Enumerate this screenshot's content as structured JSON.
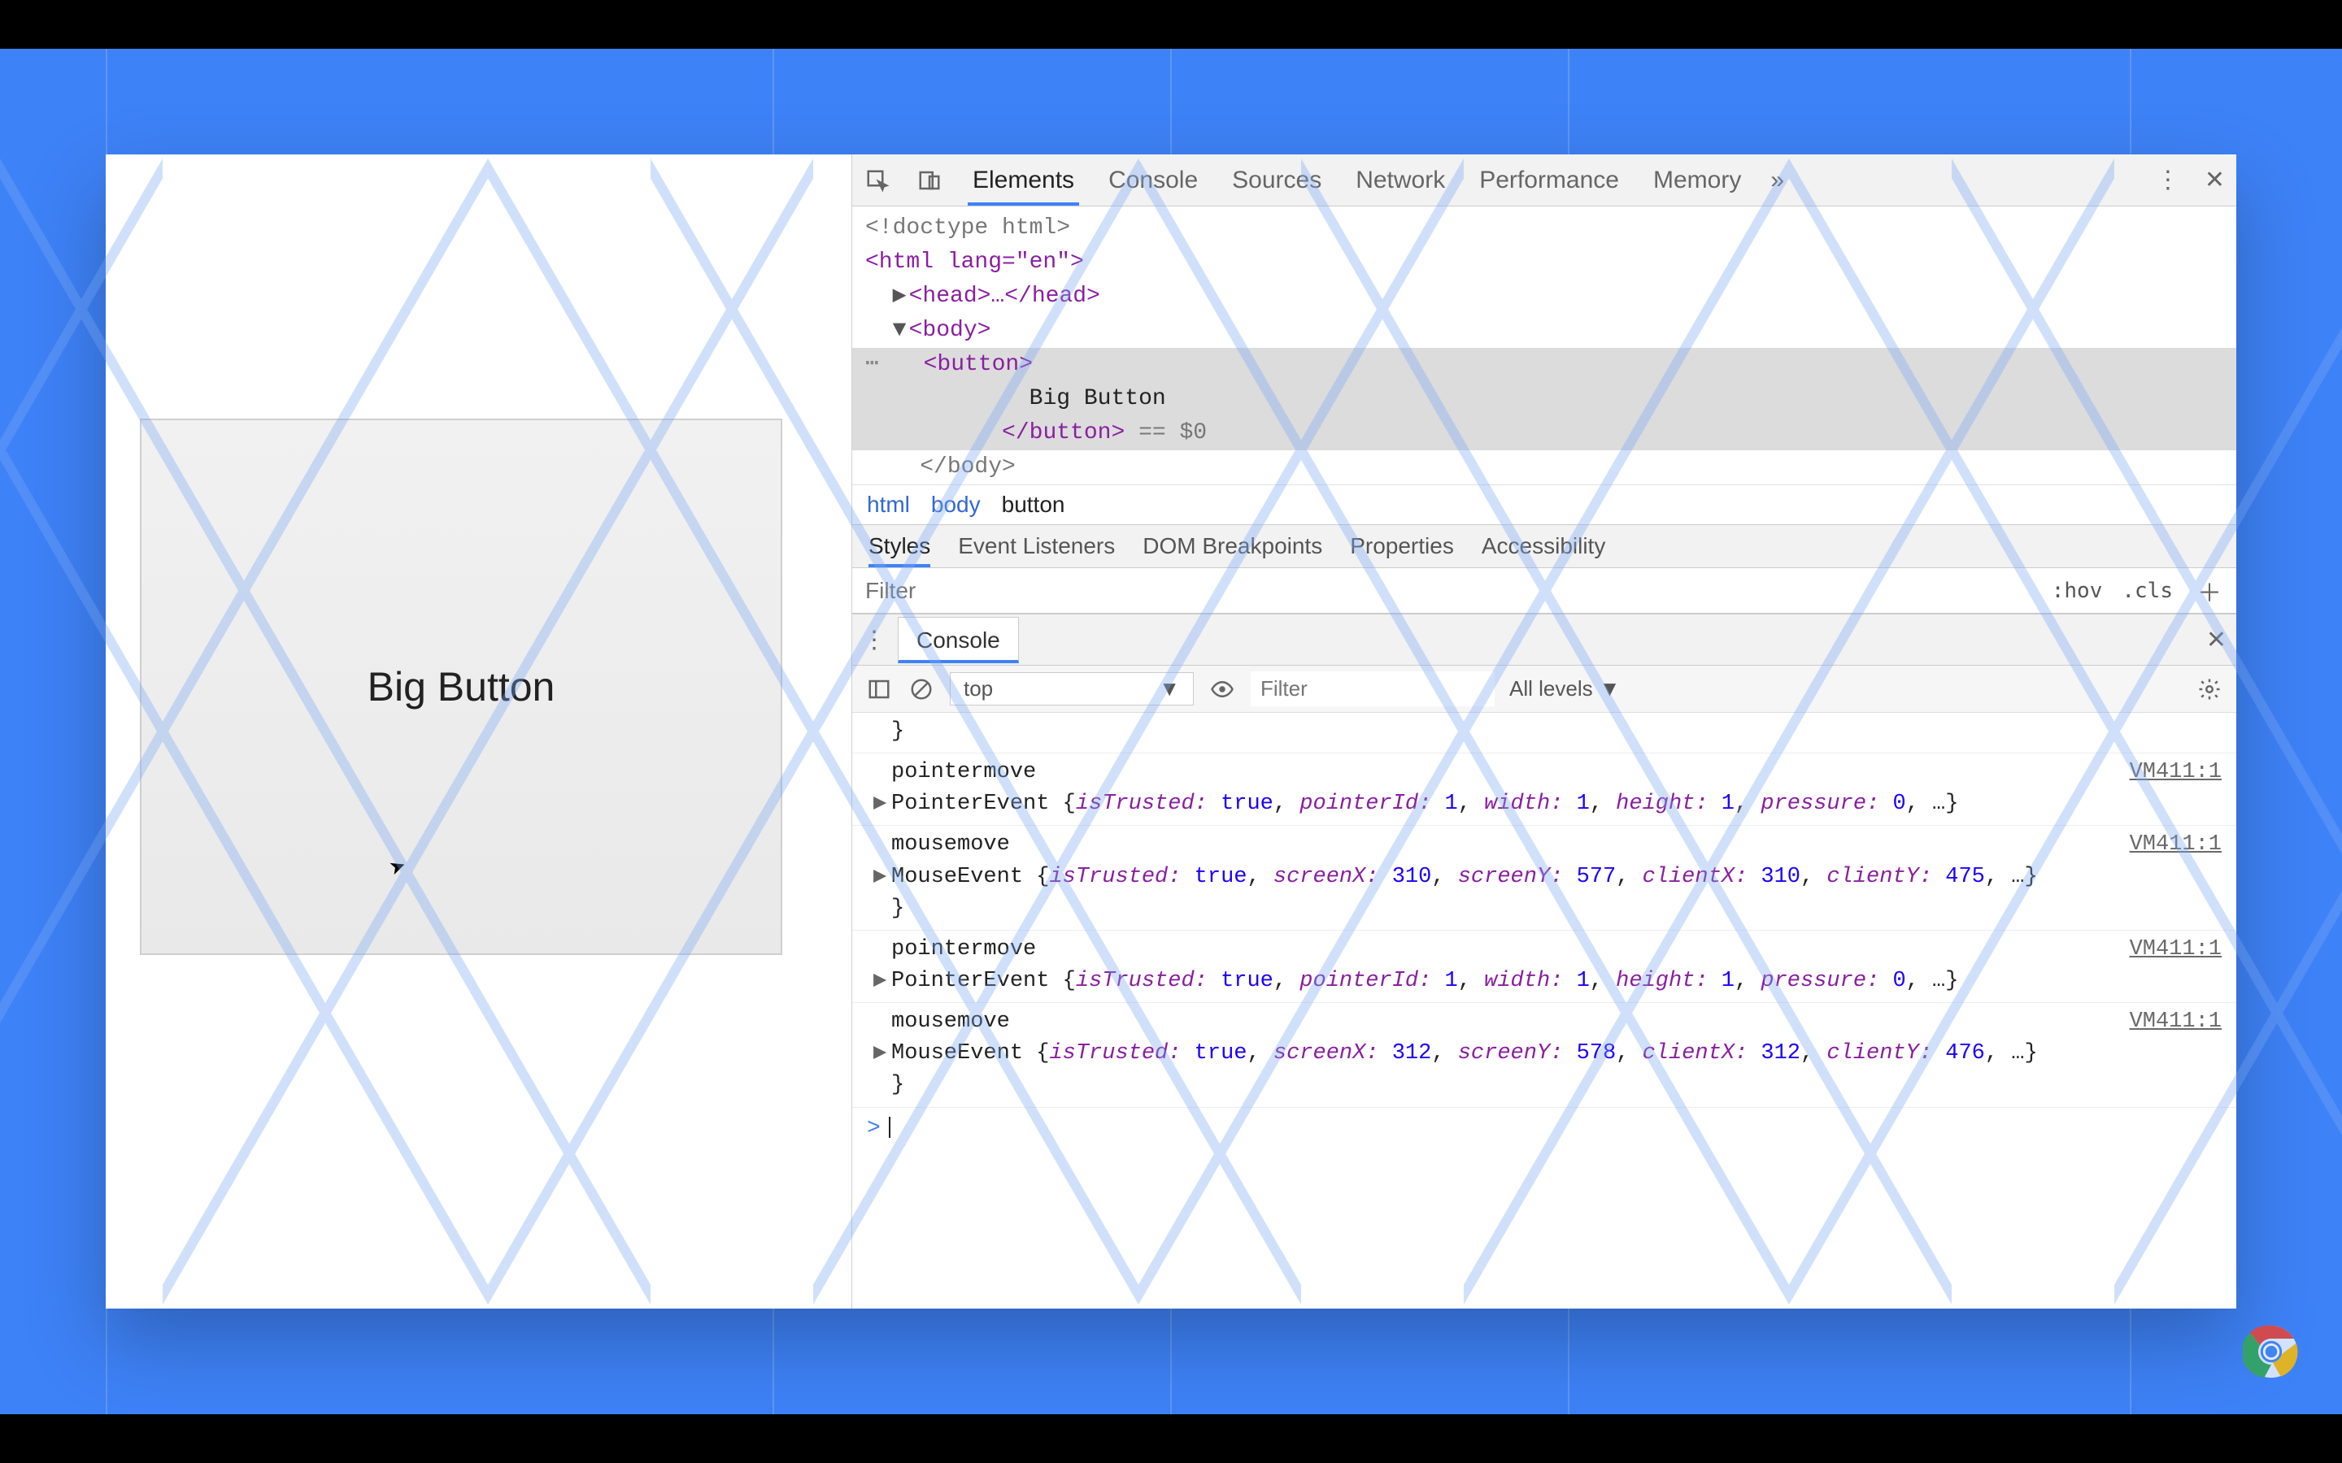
{
  "page": {
    "button_label": "Big Button"
  },
  "devtools": {
    "tabs": [
      "Elements",
      "Console",
      "Sources",
      "Network",
      "Performance",
      "Memory"
    ],
    "active_tab": "Elements",
    "dom": {
      "doctype": "<!doctype html>",
      "html_open": "<html lang=\"en\">",
      "head_collapsed": "<head>…</head>",
      "body_open": "<body>",
      "button_open": "<button>",
      "button_text": "Big Button",
      "button_close": "</button>",
      "inspected_suffix": " == $0",
      "body_close": "</body>"
    },
    "breadcrumb": [
      "html",
      "body",
      "button"
    ],
    "subtabs": [
      "Styles",
      "Event Listeners",
      "DOM Breakpoints",
      "Properties",
      "Accessibility"
    ],
    "active_subtab": "Styles",
    "styles_filter_placeholder": "Filter",
    "hov_label": ":hov",
    "cls_label": ".cls",
    "drawer": {
      "tab_label": "Console",
      "context": "top",
      "filter_placeholder": "Filter",
      "levels_label": "All levels"
    },
    "console_logs": [
      {
        "kind": "tail",
        "text": "}"
      },
      {
        "kind": "event",
        "name": "pointermove",
        "source": "VM411:1",
        "obj_prefix": "PointerEvent ",
        "props": "{isTrusted: true, pointerId: 1, width: 1, height: 1, pressure: 0, …}"
      },
      {
        "kind": "event",
        "name": "mousemove",
        "source": "VM411:1",
        "obj_prefix": "MouseEvent ",
        "props": "{isTrusted: true, screenX: 310, screenY: 577, clientX: 310, clientY: 475, …}",
        "trailing_brace": true
      },
      {
        "kind": "event",
        "name": "pointermove",
        "source": "VM411:1",
        "obj_prefix": "PointerEvent ",
        "props": "{isTrusted: true, pointerId: 1, width: 1, height: 1, pressure: 0, …}"
      },
      {
        "kind": "event",
        "name": "mousemove",
        "source": "VM411:1",
        "obj_prefix": "MouseEvent ",
        "props": "{isTrusted: true, screenX: 312, screenY: 578, clientX: 312, clientY: 476, …}",
        "trailing_brace": true
      }
    ]
  }
}
